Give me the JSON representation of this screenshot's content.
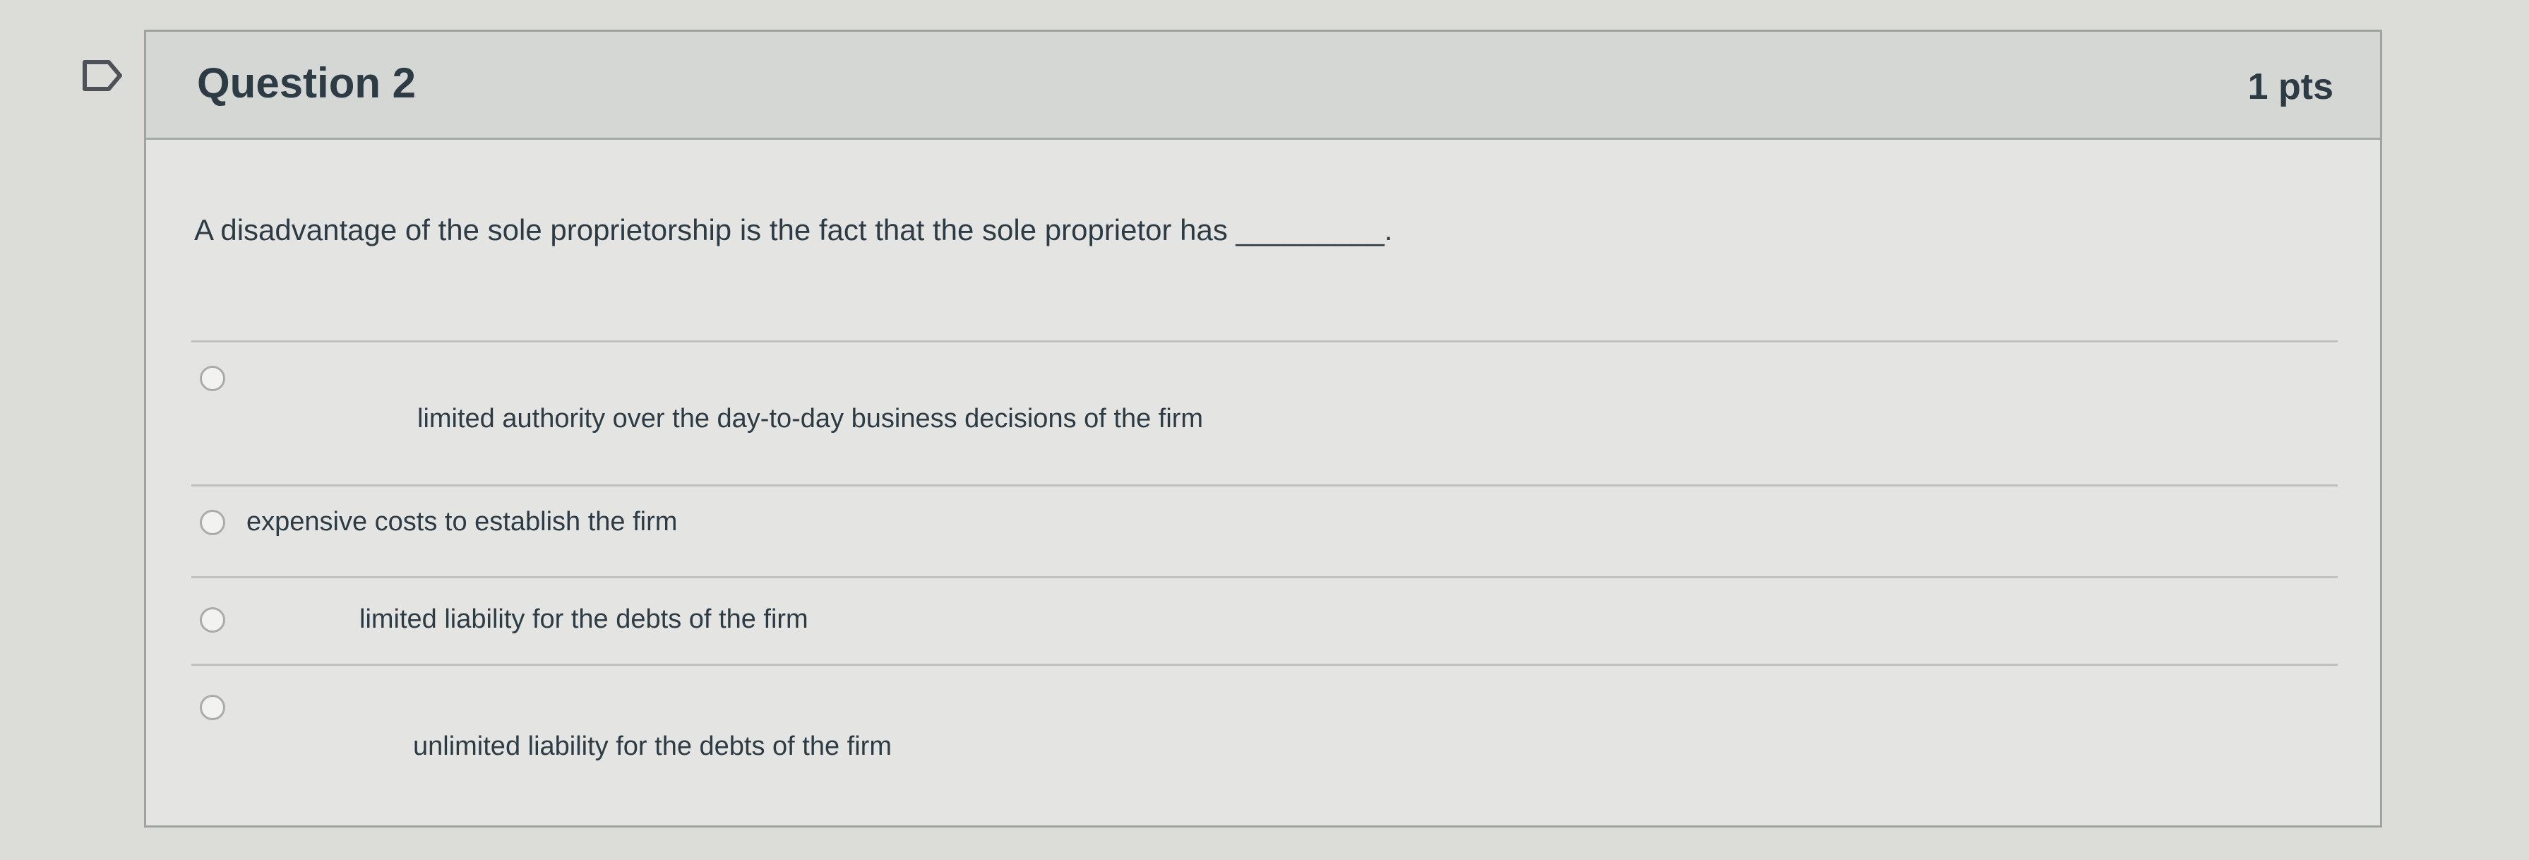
{
  "question": {
    "title": "Question 2",
    "points": "1 pts",
    "prompt": "A disadvantage of the sole proprietorship is the fact that the sole proprietor has _________."
  },
  "answers": [
    {
      "label": "limited authority over the day-to-day business decisions of the firm",
      "selected": false
    },
    {
      "label": "expensive costs to establish the firm",
      "selected": false
    },
    {
      "label": "limited liability for the debts of the firm",
      "selected": false
    },
    {
      "label": "unlimited liability for the debts of the firm",
      "selected": false
    }
  ],
  "icons": {
    "flag": "flag-icon",
    "radio": "radio-button-icon"
  },
  "colors": {
    "background": "#dcddd9",
    "header": "#d5d7d4",
    "text": "#2d3b45"
  }
}
